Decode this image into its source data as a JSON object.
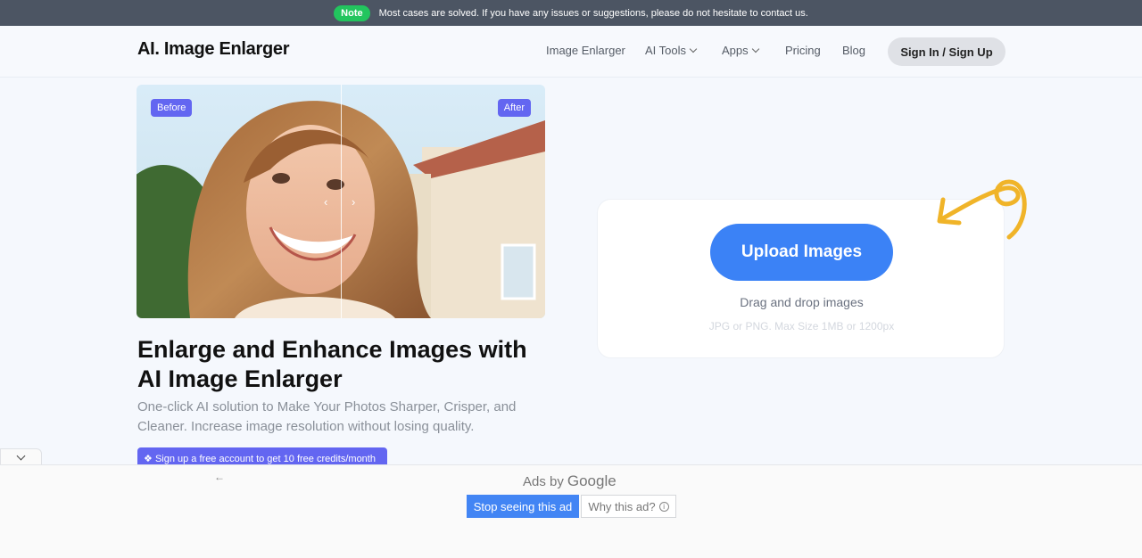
{
  "notice": {
    "badge": "Note",
    "message": "Most cases are solved. If you have any issues or suggestions, please do not hesitate to contact us."
  },
  "header": {
    "logo": "AI. Image Enlarger",
    "nav": [
      {
        "label": "Image Enlarger"
      },
      {
        "label": "AI Tools"
      },
      {
        "label": "Apps"
      },
      {
        "label": "Pricing"
      },
      {
        "label": "Blog"
      }
    ],
    "signin_label": "Sign In / Sign Up"
  },
  "compare": {
    "before_label": "Before",
    "after_label": "After",
    "left_arrow": "‹",
    "right_arrow": "›"
  },
  "hero": {
    "headline": "Enlarge and Enhance Images with AI Image Enlarger",
    "subtitle": "One-click AI solution to Make Your Photos Sharper, Crisper, and Cleaner. Increase image resolution without losing quality.",
    "promo": "Sign up a free account to get 10 free credits/month"
  },
  "upload": {
    "button_label": "Upload Images",
    "drag_text": "Drag and drop images",
    "hint": "JPG or PNG. Max Size 1MB or 1200px"
  },
  "ad": {
    "back_arrow": "←",
    "ads_by": "Ads by",
    "google": "Google",
    "stop_label": "Stop seeing this ad",
    "why_label": "Why this ad?",
    "info": "i"
  },
  "colors": {
    "accent": "#3b82f6",
    "tag": "#6366f1",
    "note_badge": "#22c55e",
    "notice_bar": "#4c5563",
    "swirl": "#f0b429"
  }
}
